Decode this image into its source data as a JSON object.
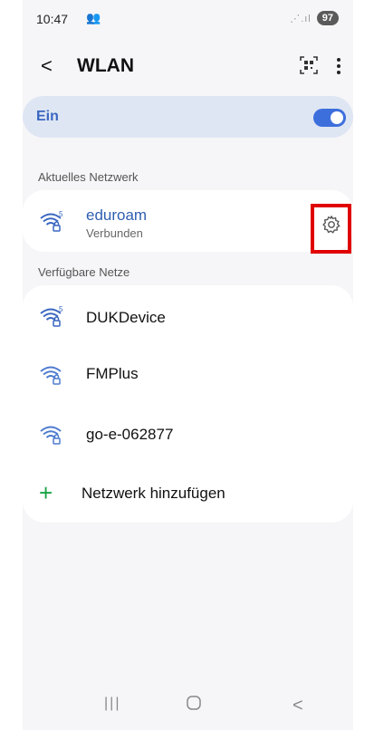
{
  "status": {
    "time": "10:47",
    "battery": "97"
  },
  "header": {
    "title": "WLAN"
  },
  "wifi_toggle": {
    "label": "Ein",
    "state": "on",
    "accent": "#3d6fdc"
  },
  "current_section": {
    "title": "Aktuelles Netzwerk",
    "network": {
      "name": "eduroam",
      "status": "Verbunden",
      "icon": "wifi-6-lock-icon"
    }
  },
  "available_section": {
    "title": "Verfügbare Netze",
    "networks": [
      {
        "name": "DUKDevice",
        "icon": "wifi-6-lock-icon"
      },
      {
        "name": "FMPlus",
        "icon": "wifi-lock-icon"
      },
      {
        "name": "go-e-062877",
        "icon": "wifi-lock-icon"
      }
    ],
    "add_label": "Netzwerk hinzufügen"
  },
  "highlight_color": "#e00000"
}
